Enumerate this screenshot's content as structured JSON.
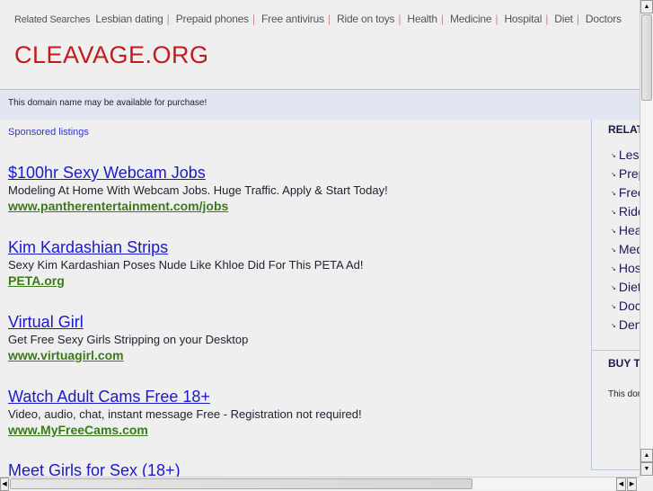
{
  "top_bar": {
    "label": "Related Searches",
    "links": [
      "Lesbian dating",
      "Prepaid phones",
      "Free antivirus",
      "Ride on toys",
      "Health",
      "Medicine",
      "Hospital",
      "Diet",
      "Doctors"
    ]
  },
  "logo": "CLEAVAGE.ORG",
  "notice": "This domain name may be available for purchase!",
  "sponsored_label": "Sponsored listings",
  "ads": [
    {
      "title": "$100hr Sexy Webcam Jobs",
      "desc": "Modeling At Home With Webcam Jobs. Huge Traffic. Apply & Start Today!",
      "url": "www.pantherentertainment.com/jobs"
    },
    {
      "title": "Kim Kardashian Strips",
      "desc": "Sexy Kim Kardashian Poses Nude Like Khloe Did For This PETA Ad!",
      "url": "PETA.org"
    },
    {
      "title": "Virtual Girl",
      "desc": "Get Free Sexy Girls Stripping on your Desktop",
      "url": "www.virtuagirl.com"
    },
    {
      "title": "Watch Adult Cams Free 18+",
      "desc": "Video, audio, chat, instant message Free - Registration not required!",
      "url": "www.MyFreeCams.com"
    },
    {
      "title": "Meet Girls for Sex (18+)"
    }
  ],
  "sidebar": {
    "related_heading": "RELAT",
    "items": [
      "Lesbian dating",
      "Prepaid phones",
      "Free antivirus",
      "Ride on toys",
      "Health",
      "Medicine",
      "Hospital",
      "Diet",
      "Doctors",
      "Den"
    ],
    "buy_heading": "BUY T",
    "buy_text": "This dom"
  }
}
